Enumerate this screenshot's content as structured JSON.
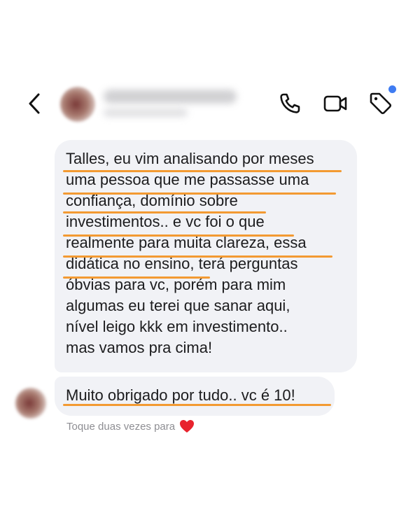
{
  "header": {
    "back_icon": "chevron-left-icon",
    "actions": [
      {
        "name": "phone",
        "icon": "phone-icon"
      },
      {
        "name": "video",
        "icon": "video-camera-icon"
      },
      {
        "name": "tag",
        "icon": "tag-icon"
      }
    ],
    "notification_dot_color": "#3f7cf2"
  },
  "messages": [
    {
      "lines": [
        "Talles, eu vim analisando por meses",
        "uma pessoa que me passasse uma",
        "confiança, domínio sobre",
        "investimentos.. e vc foi o que",
        "realmente para muita clareza, essa",
        "didática no ensino, terá perguntas",
        "óbvias para vc, porém para mim",
        "algumas eu terei que sanar aqui,",
        "nível leigo kkk em investimento..",
        "mas vamos pra cima!"
      ]
    },
    {
      "lines": [
        "Muito obrigado por tudo.. vc é 10!"
      ]
    }
  ],
  "reaction_hint": {
    "text": "Toque duas vezes para",
    "icon": "heart-icon",
    "color": "#e8232d"
  },
  "colors": {
    "bubble": "#f1f2f6",
    "highlight_underline": "#f39a32",
    "text": "#1c1c1e",
    "hint_text": "#8e8e93"
  }
}
